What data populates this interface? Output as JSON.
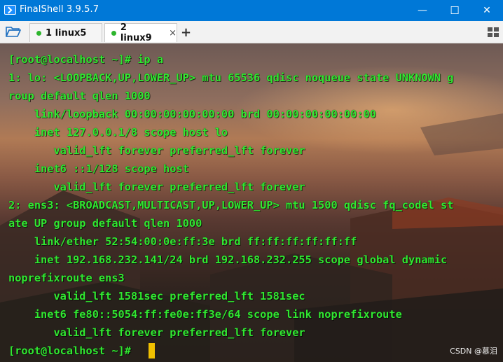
{
  "window": {
    "title": "FinalShell 3.9.5.7",
    "controls": {
      "minimize": "—",
      "maximize": "☐",
      "close": "✕"
    }
  },
  "toolbar": {
    "tabs": [
      {
        "label": "1 linux5",
        "status_color": "#2db52d",
        "active": false
      },
      {
        "label": "2 linux9",
        "status_color": "#2db52d",
        "active": true
      }
    ],
    "tab_close": "×",
    "add_tab": "+"
  },
  "terminal": {
    "lines": [
      "[root@localhost ~]# ip a",
      "1: lo: <LOOPBACK,UP,LOWER_UP> mtu 65536 qdisc noqueue state UNKNOWN g",
      "roup default qlen 1000",
      "    link/loopback 00:00:00:00:00:00 brd 00:00:00:00:00:00",
      "    inet 127.0.0.1/8 scope host lo",
      "       valid_lft forever preferred_lft forever",
      "    inet6 ::1/128 scope host",
      "       valid_lft forever preferred_lft forever",
      "2: ens3: <BROADCAST,MULTICAST,UP,LOWER_UP> mtu 1500 qdisc fq_codel st",
      "ate UP group default qlen 1000",
      "    link/ether 52:54:00:0e:ff:3e brd ff:ff:ff:ff:ff:ff",
      "    inet 192.168.232.141/24 brd 192.168.232.255 scope global dynamic",
      "noprefixroute ens3",
      "       valid_lft 1581sec preferred_lft 1581sec",
      "    inet6 fe80::5054:ff:fe0e:ff3e/64 scope link noprefixroute",
      "       valid_lft forever preferred_lft forever",
      "[root@localhost ~]# "
    ],
    "text_color": "#31e831",
    "cursor_color": "#f0c000"
  },
  "watermark": "CSDN @慕泪"
}
